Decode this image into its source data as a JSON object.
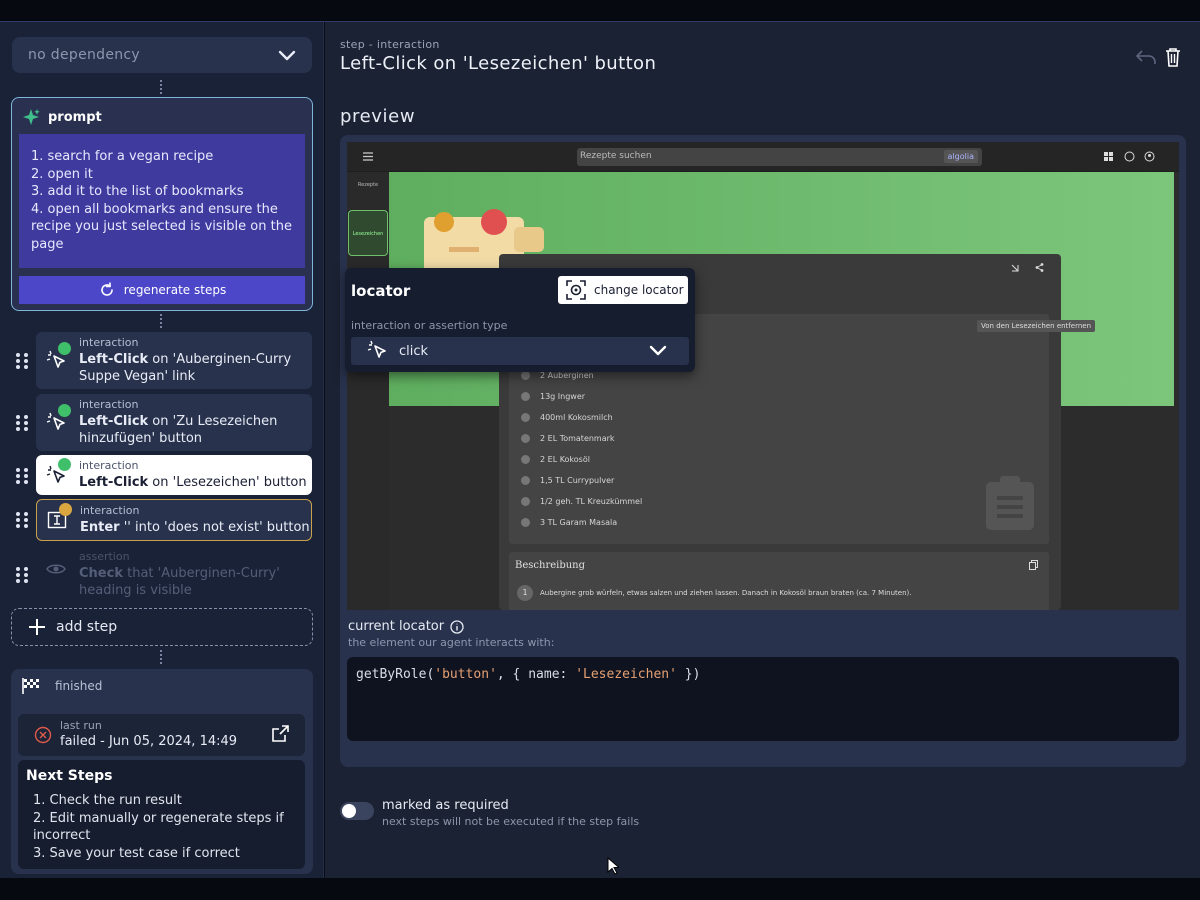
{
  "dependency": {
    "selected": "no dependency"
  },
  "prompt": {
    "title": "prompt",
    "lines": [
      "1. search for a vegan recipe",
      "2. open it",
      "3. add it to the list of bookmarks",
      "4. open all bookmarks and ensure the recipe you just selected is visible on the page"
    ],
    "regenerate_label": "regenerate steps"
  },
  "steps": [
    {
      "kind": "interaction",
      "action": "Left-Click",
      "rest": " on 'Auberginen-Curry Suppe Vegan' link",
      "status": "success"
    },
    {
      "kind": "interaction",
      "action": "Left-Click",
      "rest": " on 'Zu Lesezeichen hinzufügen' button",
      "status": "success"
    },
    {
      "kind": "interaction",
      "action": "Left-Click",
      "rest": " on 'Lesezeichen' button",
      "status": "success"
    },
    {
      "kind": "interaction",
      "action": "Enter",
      "rest": " '' into 'does not exist' button",
      "status": "warning"
    },
    {
      "kind": "assertion",
      "action": "Check",
      "rest": " that 'Auberginen-Curry' heading is visible",
      "status": "pending"
    }
  ],
  "add_step_label": "add step",
  "finished": {
    "label": "finished",
    "last_run_label": "last run",
    "last_run_value": "failed - Jun 05, 2024, 14:49",
    "next_steps_title": "Next Steps",
    "next_steps": [
      "1. Check the run result",
      "2. Edit manually or regenerate steps if incorrect",
      "3. Save your test case if correct"
    ]
  },
  "header": {
    "subtitle": "step - interaction",
    "title": "Left-Click on 'Lesezeichen' button"
  },
  "preview": {
    "label": "preview",
    "screenshot": {
      "search_placeholder": "Rezepte suchen",
      "algolia": "algolia",
      "side_items": [
        "Rezepte",
        "Lesezeichen"
      ],
      "tooltip": "Von den Lesezeichen entfernen",
      "ingredients": [
        "2 Auberginen",
        "13g Ingwer",
        "400ml Kokosmilch",
        "2 EL Tomatenmark",
        "2 EL Kokosöl",
        "1,5 TL Currypulver",
        "1/2 geh. TL Kreuzkümmel",
        "3 TL Garam Masala"
      ],
      "description_title": "Beschreibung",
      "description_step": "Aubergine grob würfeln, etwas salzen und ziehen lassen. Danach in Kokosöl braun braten (ca. 7 Minuten).",
      "description_step_number": "1"
    },
    "locator_popup": {
      "title": "locator",
      "change_label": "change locator",
      "type_label": "interaction or assertion type",
      "type_value": "click"
    },
    "current_locator_label": "current locator",
    "current_locator_sub": "the element our agent interacts with:",
    "code": {
      "prefix": "getByRole(",
      "arg1": "'button'",
      "mid": ", { name: ",
      "arg2": "'Lesezeichen'",
      "suffix": " })"
    }
  },
  "required": {
    "label": "marked as required",
    "sub": "next steps will not be executed if the step fails",
    "enabled": false
  },
  "colors": {
    "accent": "#4c47c9",
    "prompt_bg": "#3f3b9e",
    "success": "#3fbf6a",
    "warning": "#d9a640",
    "error": "#e05a4a"
  }
}
